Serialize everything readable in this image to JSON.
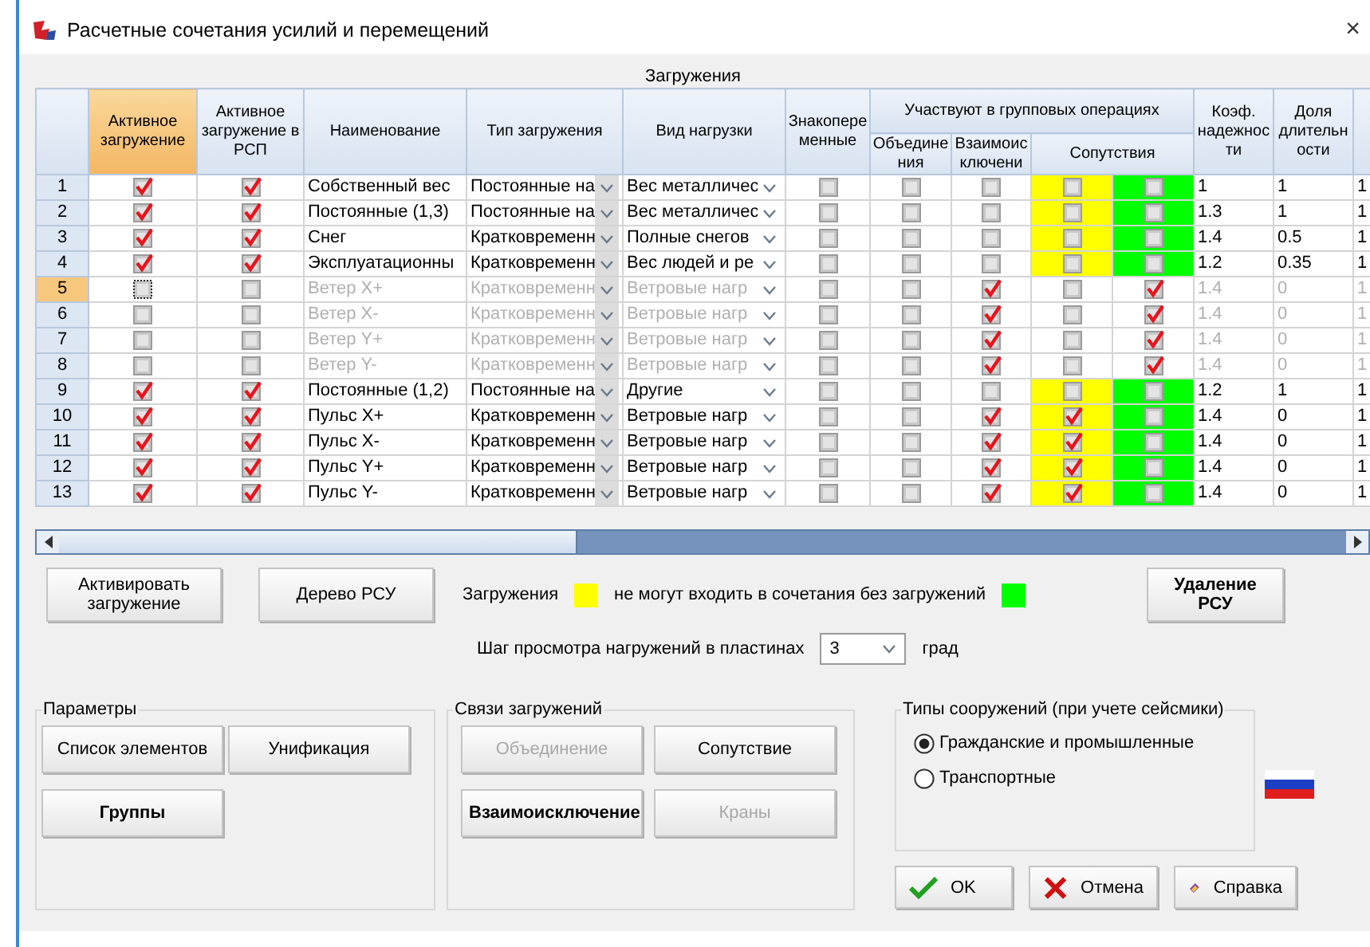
{
  "window": {
    "title": "Расчетные сочетания усилий и перемещений",
    "close": "×"
  },
  "table": {
    "caption": "Загружения",
    "columns": {
      "active": "Активное загружение",
      "rsp": "Активное загружение в РСП",
      "name": "Наименование",
      "type": "Тип загружения",
      "load": "Вид нагрузки",
      "sign": "Знакопеременные",
      "group": "Участвуют в групповых операциях",
      "merge": "Объединения",
      "exclude": "Взаимоисключени",
      "accomp": "Сопутствия",
      "factor": "Коэф. надежности",
      "share": "Доля длительности"
    },
    "rows": [
      {
        "num": "1",
        "selected": false,
        "disabled": false,
        "active": true,
        "rsp": true,
        "name": "Собственный вес",
        "type": "Постоянные на",
        "load": "Вес металличес",
        "sign": false,
        "merge": false,
        "exclude": false,
        "accomp_1": false,
        "accomp_2": false,
        "factor": "1",
        "share": "1",
        "column_14": "1"
      },
      {
        "num": "2",
        "selected": false,
        "disabled": false,
        "active": true,
        "rsp": true,
        "name": "Постоянные (1,3)",
        "type": "Постоянные на",
        "load": "Вес металличес",
        "sign": false,
        "merge": false,
        "exclude": false,
        "accomp_1": false,
        "accomp_2": false,
        "factor": "1.3",
        "share": "1",
        "column_14": "1"
      },
      {
        "num": "3",
        "selected": false,
        "disabled": false,
        "active": true,
        "rsp": true,
        "name": "Снег",
        "type": "Кратковременн",
        "load": "Полные снегов",
        "sign": false,
        "merge": false,
        "exclude": false,
        "accomp_1": false,
        "accomp_2": false,
        "factor": "1.4",
        "share": "0.5",
        "column_14": "1"
      },
      {
        "num": "4",
        "selected": false,
        "disabled": false,
        "active": true,
        "rsp": true,
        "name": "Эксплуатационны",
        "type": "Кратковременн",
        "load": "Вес людей и ре",
        "sign": false,
        "merge": false,
        "exclude": false,
        "accomp_1": false,
        "accomp_2": false,
        "factor": "1.2",
        "share": "0.35",
        "column_14": "1"
      },
      {
        "num": "5",
        "selected": true,
        "disabled": true,
        "active": false,
        "rsp": false,
        "name": "Ветер X+",
        "type": "Кратковременн",
        "load": "Ветровые нагр",
        "sign": false,
        "merge": false,
        "exclude": true,
        "accomp_1": false,
        "accomp_2": true,
        "factor": "1.4",
        "share": "0",
        "column_14": "1"
      },
      {
        "num": "6",
        "selected": false,
        "disabled": true,
        "active": false,
        "rsp": false,
        "name": "Ветер X-",
        "type": "Кратковременн",
        "load": "Ветровые нагр",
        "sign": false,
        "merge": false,
        "exclude": true,
        "accomp_1": false,
        "accomp_2": true,
        "factor": "1.4",
        "share": "0",
        "column_14": "1"
      },
      {
        "num": "7",
        "selected": false,
        "disabled": true,
        "active": false,
        "rsp": false,
        "name": "Ветер Y+",
        "type": "Кратковременн",
        "load": "Ветровые нагр",
        "sign": false,
        "merge": false,
        "exclude": true,
        "accomp_1": false,
        "accomp_2": true,
        "factor": "1.4",
        "share": "0",
        "column_14": "1"
      },
      {
        "num": "8",
        "selected": false,
        "disabled": true,
        "active": false,
        "rsp": false,
        "name": "Ветер Y-",
        "type": "Кратковременн",
        "load": "Ветровые нагр",
        "sign": false,
        "merge": false,
        "exclude": true,
        "accomp_1": false,
        "accomp_2": true,
        "factor": "1.4",
        "share": "0",
        "column_14": "1"
      },
      {
        "num": "9",
        "selected": false,
        "disabled": false,
        "active": true,
        "rsp": true,
        "name": "Постоянные (1,2)",
        "type": "Постоянные на",
        "load": "Другие",
        "sign": false,
        "merge": false,
        "exclude": false,
        "accomp_1": false,
        "accomp_2": false,
        "factor": "1.2",
        "share": "1",
        "column_14": "1"
      },
      {
        "num": "10",
        "selected": false,
        "disabled": false,
        "active": true,
        "rsp": true,
        "name": "Пульс X+",
        "type": "Кратковременн",
        "load": "Ветровые нагр",
        "sign": false,
        "merge": false,
        "exclude": true,
        "accomp_1": true,
        "accomp_2": false,
        "factor": "1.4",
        "share": "0",
        "column_14": "1"
      },
      {
        "num": "11",
        "selected": false,
        "disabled": false,
        "active": true,
        "rsp": true,
        "name": "Пульс X-",
        "type": "Кратковременн",
        "load": "Ветровые нагр",
        "sign": false,
        "merge": false,
        "exclude": true,
        "accomp_1": true,
        "accomp_2": false,
        "factor": "1.4",
        "share": "0",
        "column_14": "1"
      },
      {
        "num": "12",
        "selected": false,
        "disabled": false,
        "active": true,
        "rsp": true,
        "name": "Пульс Y+",
        "type": "Кратковременн",
        "load": "Ветровые нагр",
        "sign": false,
        "merge": false,
        "exclude": true,
        "accomp_1": true,
        "accomp_2": false,
        "factor": "1.4",
        "share": "0",
        "column_14": "1"
      },
      {
        "num": "13",
        "selected": false,
        "disabled": false,
        "active": true,
        "rsp": true,
        "name": "Пульс Y-",
        "type": "Кратковременн",
        "load": "Ветровые нагр",
        "sign": false,
        "merge": false,
        "exclude": true,
        "accomp_1": true,
        "accomp_2": false,
        "factor": "1.4",
        "share": "0",
        "column_14": "1"
      }
    ]
  },
  "buttons_top": [
    {
      "label": "Активировать загружение",
      "bold": false,
      "disabled": false
    },
    {
      "label": "Дерево РСУ",
      "bold": false,
      "disabled": false
    }
  ],
  "legend": [
    {
      "kind": "text",
      "text": "Загружения"
    },
    {
      "kind": "swatch",
      "color": "#ffff00"
    },
    {
      "kind": "text",
      "text": "не могут входить в сочетания без загружений"
    },
    {
      "kind": "swatch",
      "color": "#00ff00"
    }
  ],
  "delete_button": {
    "label": "Удаление РСУ",
    "bold": true,
    "disabled": false
  },
  "step": {
    "label": "Шаг просмотра нагружений в пластинах",
    "value": "3",
    "unit": "град"
  },
  "parameters": {
    "title": "Параметры",
    "buttons": [
      {
        "label": "Список элементов",
        "bold": false,
        "disabled": false
      },
      {
        "label": "Унификация",
        "bold": false,
        "disabled": false
      },
      {
        "label": "Группы",
        "bold": true,
        "disabled": false
      }
    ]
  },
  "links": {
    "title": "Связи загружений",
    "buttons": [
      {
        "label": "Объединение",
        "bold": false,
        "disabled": true
      },
      {
        "label": "Сопутствие",
        "bold": false,
        "disabled": false
      },
      {
        "label": "Взаимоисключение",
        "bold": true,
        "disabled": false
      },
      {
        "label": "Краны",
        "bold": false,
        "disabled": true
      }
    ]
  },
  "structure_types": {
    "title": "Типы сооружений (при учете сейсмики)",
    "options": [
      {
        "label": "Гражданские и промышленные",
        "selected": true
      },
      {
        "label": "Транспортные",
        "selected": false
      }
    ]
  },
  "dialog_buttons": [
    {
      "kind": "ok",
      "label": "OK"
    },
    {
      "kind": "cancel",
      "label": "Отмена"
    },
    {
      "kind": "help",
      "label": "Справка"
    }
  ]
}
